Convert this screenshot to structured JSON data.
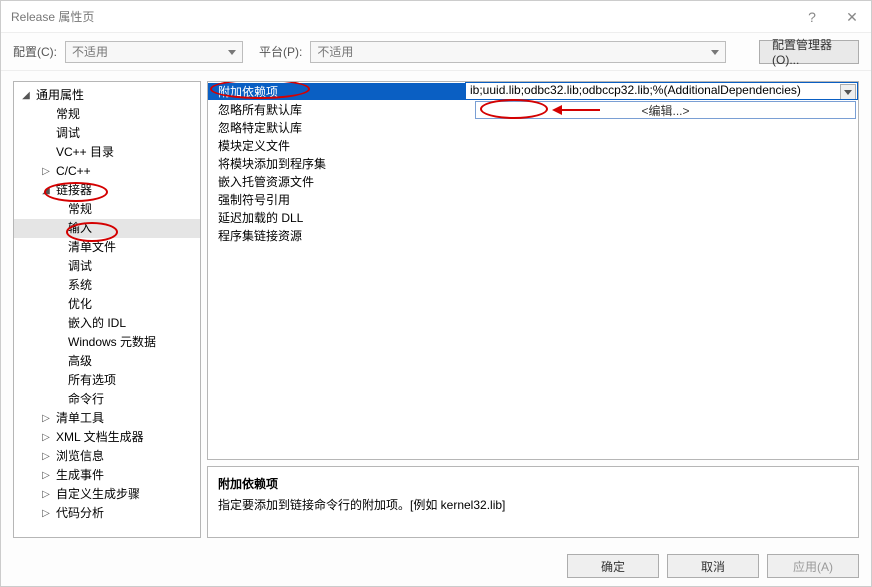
{
  "title": "Release 属性页",
  "sysicons": {
    "help": "?",
    "close": "✕"
  },
  "config_row": {
    "config_label": "配置(C):",
    "config_value": "不适用",
    "platform_label": "平台(P):",
    "platform_value": "不适用",
    "manager_btn": "配置管理器(O)..."
  },
  "tree": {
    "root": {
      "label": "通用属性",
      "expanded": true,
      "children": [
        {
          "label": "常规"
        },
        {
          "label": "调试"
        },
        {
          "label": "VC++ 目录"
        },
        {
          "label": "C/C++",
          "expandable": true,
          "expanded": false
        },
        {
          "label": "链接器",
          "expandable": true,
          "expanded": true,
          "children": [
            {
              "label": "常规"
            },
            {
              "label": "输入",
              "selected": true
            },
            {
              "label": "清单文件"
            },
            {
              "label": "调试"
            },
            {
              "label": "系统"
            },
            {
              "label": "优化"
            },
            {
              "label": "嵌入的 IDL"
            },
            {
              "label": "Windows 元数据"
            },
            {
              "label": "高级"
            },
            {
              "label": "所有选项"
            },
            {
              "label": "命令行"
            }
          ]
        },
        {
          "label": "清单工具",
          "expandable": true,
          "expanded": false
        },
        {
          "label": "XML 文档生成器",
          "expandable": true,
          "expanded": false
        },
        {
          "label": "浏览信息",
          "expandable": true,
          "expanded": false
        },
        {
          "label": "生成事件",
          "expandable": true,
          "expanded": false
        },
        {
          "label": "自定义生成步骤",
          "expandable": true,
          "expanded": false
        },
        {
          "label": "代码分析",
          "expandable": true,
          "expanded": false
        }
      ]
    }
  },
  "grid": {
    "rows": [
      {
        "name": "附加依赖项",
        "value": "ib;uuid.lib;odbc32.lib;odbccp32.lib;%(AdditionalDependencies)",
        "selected": true
      },
      {
        "name": "忽略所有默认库",
        "value": ""
      },
      {
        "name": "忽略特定默认库",
        "value": ""
      },
      {
        "name": "模块定义文件",
        "value": ""
      },
      {
        "name": "将模块添加到程序集",
        "value": ""
      },
      {
        "name": "嵌入托管资源文件",
        "value": ""
      },
      {
        "name": "强制符号引用",
        "value": ""
      },
      {
        "name": "延迟加载的 DLL",
        "value": ""
      },
      {
        "name": "程序集链接资源",
        "value": ""
      }
    ],
    "edit_option": "<编辑...>"
  },
  "desc": {
    "heading": "附加依赖项",
    "body": "指定要添加到链接命令行的附加项。[例如 kernel32.lib]"
  },
  "footer": {
    "ok": "确定",
    "cancel": "取消",
    "apply": "应用(A)"
  }
}
